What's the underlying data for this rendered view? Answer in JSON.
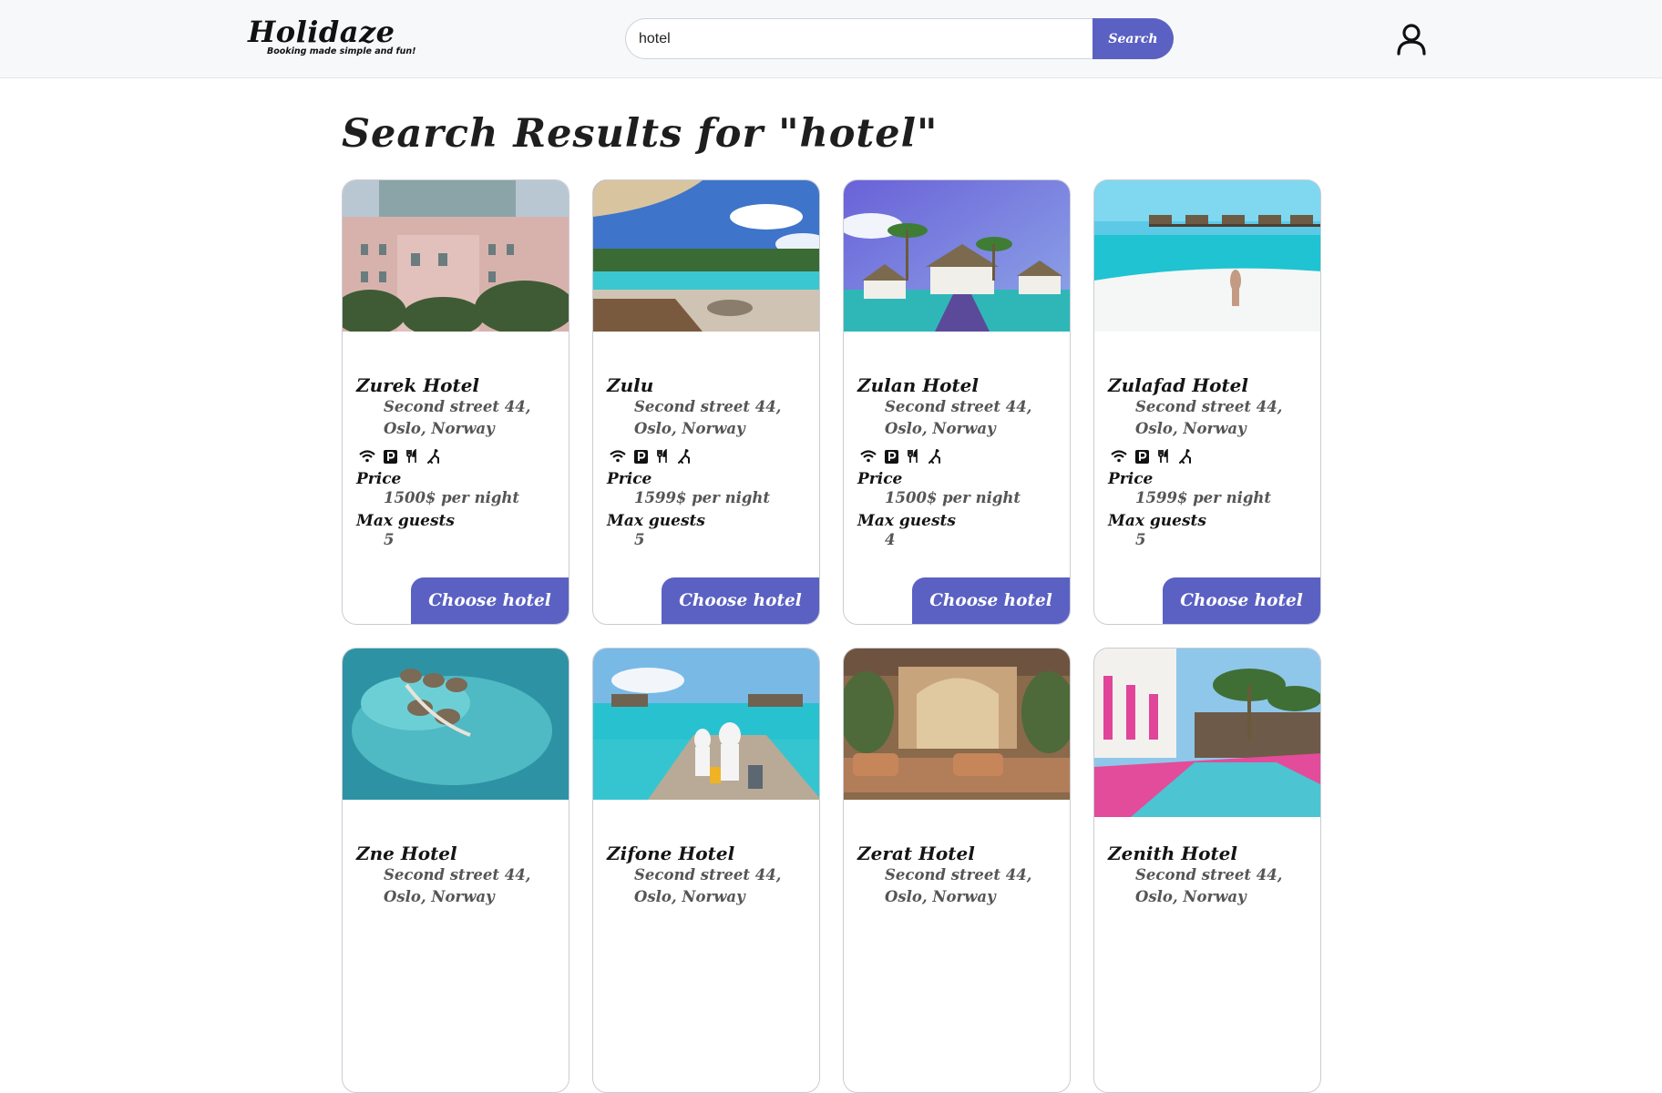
{
  "header": {
    "logo_title": "Holidaze",
    "logo_tagline": "Booking made simple and fun!",
    "search": {
      "value": "hotel",
      "button_label": "Search"
    },
    "user_icon": "user-icon"
  },
  "main": {
    "title": "Search Results for \"hotel\"",
    "labels": {
      "price": "Price",
      "max_guests": "Max guests",
      "choose": "Choose hotel"
    },
    "amenity_icons": [
      "wifi-icon",
      "parking-icon",
      "restaurant-icon",
      "pets-icon"
    ],
    "hotels": [
      {
        "name": "Zurek Hotel",
        "address": "Second street 44, Oslo, Norway",
        "price": "1500$ per night",
        "max_guests": "5",
        "image": "pink-hotel-palms"
      },
      {
        "name": "Zulu",
        "address": "Second street 44, Oslo, Norway",
        "price": "1599$ per night",
        "max_guests": "5",
        "image": "pool-umbrella"
      },
      {
        "name": "Zulan Hotel",
        "address": "Second street 44, Oslo, Norway",
        "price": "1500$ per night",
        "max_guests": "4",
        "image": "beach-huts-palms"
      },
      {
        "name": "Zulafad Hotel",
        "address": "Second street 44, Oslo, Norway",
        "price": "1599$ per night",
        "max_guests": "5",
        "image": "tropical-beach-woman"
      },
      {
        "name": "Zne Hotel",
        "address": "Second street 44, Oslo, Norway",
        "price": "",
        "max_guests": "",
        "image": "aerial-water-villas"
      },
      {
        "name": "Zifone Hotel",
        "address": "Second street 44, Oslo, Norway",
        "price": "",
        "max_guests": "",
        "image": "couple-pier-luggage"
      },
      {
        "name": "Zerat Hotel",
        "address": "Second street 44, Oslo, Norway",
        "price": "",
        "max_guests": "",
        "image": "ornate-lobby"
      },
      {
        "name": "Zenith Hotel",
        "address": "Second street 44, Oslo, Norway",
        "price": "",
        "max_guests": "",
        "image": "pink-pool-resort"
      }
    ]
  },
  "colors": {
    "accent": "#5a61c2",
    "header_bg": "#f7f8fa",
    "text": "#1c1c1c",
    "muted": "#555555"
  }
}
